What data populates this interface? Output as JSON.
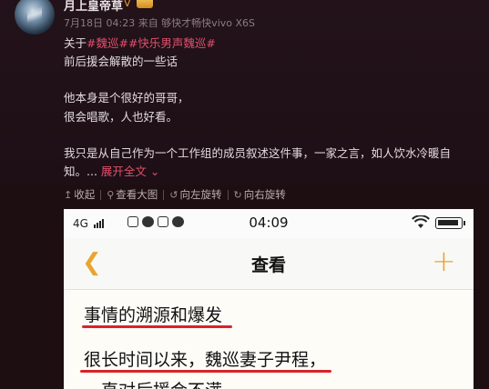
{
  "post": {
    "username": "月上皇帝草",
    "verified_badge": "V",
    "meta": "7月18日 04:23 来自 够快才畅快vivo X6S",
    "about_prefix": "关于",
    "tags": "#魏巡##快乐男声魏巡#",
    "lines": [
      "前后援会解散的一些话",
      "他本身是个很好的哥哥，",
      "很会唱歌，人也好看。",
      "我只是从自己作为一个工作组的成员叙述这件事，一家之言，如人饮水冷暖自",
      "知。..."
    ],
    "expand_label": "展开全文",
    "expand_icon": "chevron-down"
  },
  "toolbar": {
    "collapse": "收起",
    "view_large": "查看大图",
    "rotate_left": "向左旋转",
    "rotate_right": "向右旋转"
  },
  "embedded_screenshot": {
    "carrier": "4G",
    "time": "04:09",
    "nav_back_icon": "chevron-left",
    "nav_title": "查看",
    "nav_add_icon": "plus",
    "note_lines": [
      "事情的溯源和爆发",
      "很长时间以来，魏巡妻子尹程，",
      "一直对后援会不满"
    ],
    "accent_color": "#e8a531",
    "underline_color": "#d9232a"
  }
}
